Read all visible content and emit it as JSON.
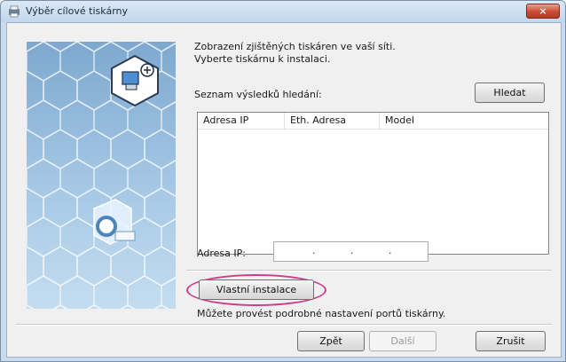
{
  "window": {
    "title": "Výběr cílové tiskárny",
    "close_label": "×"
  },
  "description": {
    "line1": "Zobrazení zjištěných tiskáren ve vaší síti.",
    "line2": "Vyberte tiskárnu k instalaci."
  },
  "search": {
    "results_label": "Seznam výsledků hledání:",
    "search_button": "Hledat"
  },
  "table": {
    "columns": [
      "Adresa IP",
      "Eth. Adresa",
      "Model"
    ],
    "rows": []
  },
  "ip": {
    "label": "Adresa IP:",
    "separator": "."
  },
  "custom_install": {
    "button": "Vlastní instalace",
    "hint": "Můžete provést podrobné nastavení portů tiskárny."
  },
  "footer": {
    "back": "Zpět",
    "next": "Další",
    "cancel": "Zrušit"
  },
  "colors": {
    "highlight": "#cc3d8e",
    "close_button": "#c84b33"
  },
  "icons": [
    "printer-app-icon",
    "close-icon",
    "network-printer-icon",
    "printer-cube-icon"
  ]
}
